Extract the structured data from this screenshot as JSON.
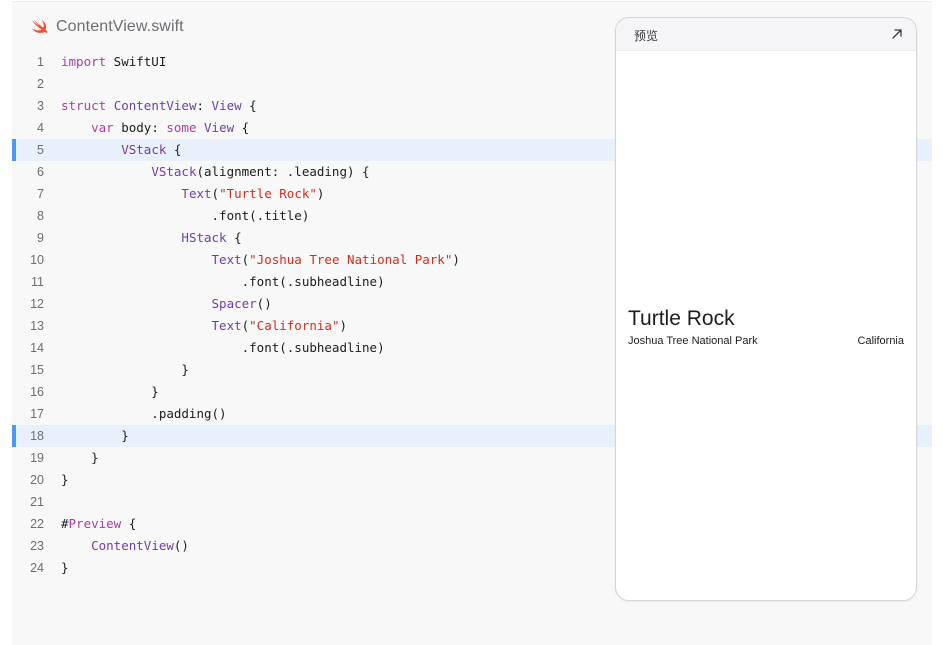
{
  "file_header": {
    "icon": "swift-logo-icon",
    "name": "ContentView.swift"
  },
  "colors": {
    "keyword": "#ad3da4",
    "type": "#703daa",
    "string": "#d12f1b",
    "highlight_bar": "#4a9af3",
    "highlight_bg": "#e8f0fb",
    "swift_logo": "#f05138"
  },
  "code": {
    "highlighted_lines": [
      5,
      18
    ],
    "lines": [
      {
        "n": "1",
        "tokens": [
          {
            "c": "k",
            "t": "import"
          },
          {
            "c": "p",
            "t": " SwiftUI"
          }
        ]
      },
      {
        "n": "2",
        "tokens": []
      },
      {
        "n": "3",
        "tokens": [
          {
            "c": "k",
            "t": "struct"
          },
          {
            "c": "p",
            "t": " "
          },
          {
            "c": "t",
            "t": "ContentView"
          },
          {
            "c": "p",
            "t": ": "
          },
          {
            "c": "t",
            "t": "View"
          },
          {
            "c": "p",
            "t": " {"
          }
        ]
      },
      {
        "n": "4",
        "tokens": [
          {
            "c": "p",
            "t": "    "
          },
          {
            "c": "k",
            "t": "var"
          },
          {
            "c": "p",
            "t": " body: "
          },
          {
            "c": "k",
            "t": "some"
          },
          {
            "c": "p",
            "t": " "
          },
          {
            "c": "t",
            "t": "View"
          },
          {
            "c": "p",
            "t": " {"
          }
        ]
      },
      {
        "n": "5",
        "tokens": [
          {
            "c": "p",
            "t": "        "
          },
          {
            "c": "t",
            "t": "VStack"
          },
          {
            "c": "p",
            "t": " {"
          }
        ]
      },
      {
        "n": "6",
        "tokens": [
          {
            "c": "p",
            "t": "            "
          },
          {
            "c": "t",
            "t": "VStack"
          },
          {
            "c": "p",
            "t": "(alignment: .leading) {"
          }
        ]
      },
      {
        "n": "7",
        "tokens": [
          {
            "c": "p",
            "t": "                "
          },
          {
            "c": "t",
            "t": "Text"
          },
          {
            "c": "p",
            "t": "("
          },
          {
            "c": "s",
            "t": "\"Turtle Rock\""
          },
          {
            "c": "p",
            "t": ")"
          }
        ]
      },
      {
        "n": "8",
        "tokens": [
          {
            "c": "p",
            "t": "                    .font(.title)"
          }
        ]
      },
      {
        "n": "9",
        "tokens": [
          {
            "c": "p",
            "t": "                "
          },
          {
            "c": "t",
            "t": "HStack"
          },
          {
            "c": "p",
            "t": " {"
          }
        ]
      },
      {
        "n": "10",
        "tokens": [
          {
            "c": "p",
            "t": "                    "
          },
          {
            "c": "t",
            "t": "Text"
          },
          {
            "c": "p",
            "t": "("
          },
          {
            "c": "s",
            "t": "\"Joshua Tree National Park\""
          },
          {
            "c": "p",
            "t": ")"
          }
        ]
      },
      {
        "n": "11",
        "tokens": [
          {
            "c": "p",
            "t": "                        .font(.subheadline)"
          }
        ]
      },
      {
        "n": "12",
        "tokens": [
          {
            "c": "p",
            "t": "                    "
          },
          {
            "c": "t",
            "t": "Spacer"
          },
          {
            "c": "p",
            "t": "()"
          }
        ]
      },
      {
        "n": "13",
        "tokens": [
          {
            "c": "p",
            "t": "                    "
          },
          {
            "c": "t",
            "t": "Text"
          },
          {
            "c": "p",
            "t": "("
          },
          {
            "c": "s",
            "t": "\"California\""
          },
          {
            "c": "p",
            "t": ")"
          }
        ]
      },
      {
        "n": "14",
        "tokens": [
          {
            "c": "p",
            "t": "                        .font(.subheadline)"
          }
        ]
      },
      {
        "n": "15",
        "tokens": [
          {
            "c": "p",
            "t": "                }"
          }
        ]
      },
      {
        "n": "16",
        "tokens": [
          {
            "c": "p",
            "t": "            }"
          }
        ]
      },
      {
        "n": "17",
        "tokens": [
          {
            "c": "p",
            "t": "            .padding()"
          }
        ]
      },
      {
        "n": "18",
        "tokens": [
          {
            "c": "p",
            "t": "        }"
          }
        ]
      },
      {
        "n": "19",
        "tokens": [
          {
            "c": "p",
            "t": "    }"
          }
        ]
      },
      {
        "n": "20",
        "tokens": [
          {
            "c": "p",
            "t": "}"
          }
        ]
      },
      {
        "n": "21",
        "tokens": []
      },
      {
        "n": "22",
        "tokens": [
          {
            "c": "p",
            "t": "#"
          },
          {
            "c": "k",
            "t": "Preview"
          },
          {
            "c": "p",
            "t": " {"
          }
        ]
      },
      {
        "n": "23",
        "tokens": [
          {
            "c": "p",
            "t": "    "
          },
          {
            "c": "t",
            "t": "ContentView"
          },
          {
            "c": "p",
            "t": "()"
          }
        ]
      },
      {
        "n": "24",
        "tokens": [
          {
            "c": "p",
            "t": "}"
          }
        ]
      }
    ]
  },
  "preview": {
    "label": "预览",
    "expand_icon": "arrow-up-right-icon",
    "title": "Turtle Rock",
    "subtitle": "Joshua Tree National Park",
    "location": "California"
  }
}
